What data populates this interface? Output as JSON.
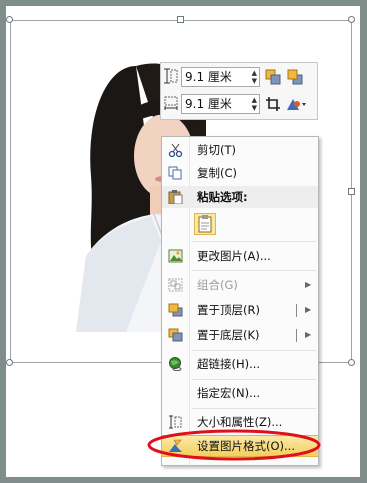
{
  "toolbar": {
    "height_value": "9.1 厘米",
    "width_value": "9.1 厘米"
  },
  "menu": {
    "items": [
      {
        "label": "剪切(T)"
      },
      {
        "label": "复制(C)"
      },
      {
        "label": "粘贴选项:"
      },
      {
        "label": "更改图片(A)..."
      },
      {
        "label": "组合(G)"
      },
      {
        "label": "置于顶层(R)"
      },
      {
        "label": "置于底层(K)"
      },
      {
        "label": "超链接(H)..."
      },
      {
        "label": "指定宏(N)..."
      },
      {
        "label": "大小和属性(Z)..."
      },
      {
        "label": "设置图片格式(O)..."
      }
    ]
  },
  "colors": {
    "highlight": "#f3cf5e",
    "annotation_ellipse": "#e0101a"
  }
}
